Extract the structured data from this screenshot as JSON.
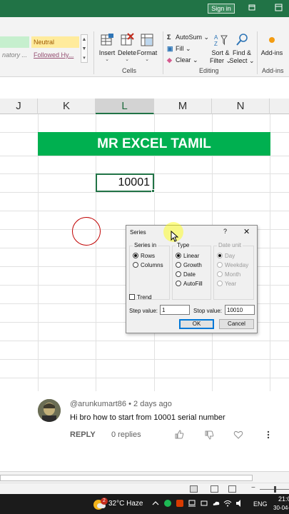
{
  "titlebar": {
    "signin_label": "Sign in"
  },
  "ribbon": {
    "styles": {
      "good": "",
      "neutral": "Neutral",
      "explanatory": "natory ...",
      "hyperlink": "Followed Hy..."
    },
    "cells": {
      "insert": "Insert",
      "delete": "Delete",
      "format": "Format",
      "group_label": "Cells"
    },
    "editing": {
      "autosum": "AutoSum",
      "fill": "Fill",
      "clear": "Clear",
      "sort_filter_1": "Sort &",
      "sort_filter_2": "Filter",
      "find_select_1": "Find &",
      "find_select_2": "Select",
      "group_label": "Editing"
    },
    "addins": {
      "label": "Add-ins",
      "group_label": "Add-ins"
    }
  },
  "columns": [
    "J",
    "K",
    "L",
    "M",
    "N"
  ],
  "selected_column": "L",
  "sheet": {
    "banner_text": "MR EXCEL TAMIL",
    "active_cell_value": "10001"
  },
  "dialog": {
    "title": "Series",
    "help": "?",
    "close": "✕",
    "series_in": {
      "legend": "Series in",
      "rows": "Rows",
      "columns": "Columns",
      "selected": "rows"
    },
    "type": {
      "legend": "Type",
      "linear": "Linear",
      "growth": "Growth",
      "date": "Date",
      "autofill": "AutoFill",
      "selected": "linear"
    },
    "date_unit": {
      "legend": "Date unit",
      "day": "Day",
      "weekday": "Weekday",
      "month": "Month",
      "year": "Year"
    },
    "trend_label": "Trend",
    "step_label": "Step value:",
    "step_value": "1",
    "stop_label": "Stop value:",
    "stop_value": "10010",
    "ok_label": "OK",
    "cancel_label": "Cancel"
  },
  "comment": {
    "username": "@arunkumart86",
    "separator": "•",
    "time": "2 days ago",
    "text": "Hi bro how to start from 10001 serial number",
    "reply_label": "REPLY",
    "replies_label": "0 replies"
  },
  "taskbar": {
    "weather_badge": "2",
    "weather_text": "32°C  Haze",
    "language": "ENG",
    "time": "21:0",
    "date": "30-04-"
  },
  "colors": {
    "excel_green": "#217346",
    "banner_green": "#00b050",
    "circle_red": "#c00000"
  },
  "icons": [
    "windows-grid-icon",
    "restore-icon",
    "insert-cells-icon",
    "delete-cells-icon",
    "format-cells-icon",
    "autosum-icon",
    "fill-icon",
    "clear-icon",
    "sort-filter-icon",
    "find-select-icon",
    "addins-icon",
    "like-icon",
    "dislike-icon",
    "heart-icon",
    "more-icon",
    "weather-icon",
    "chevron-up-icon",
    "wifi-icon",
    "speaker-icon"
  ]
}
